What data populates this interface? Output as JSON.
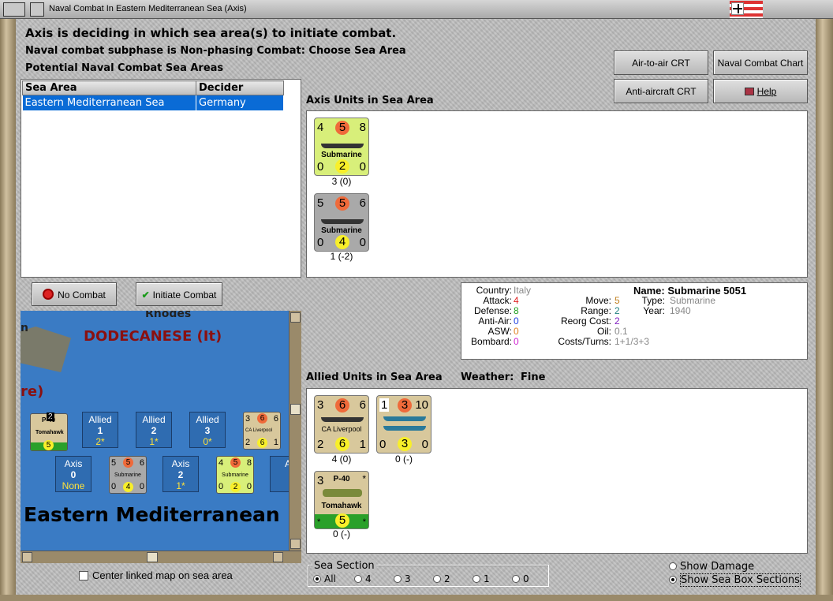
{
  "window": {
    "title": "Naval Combat In Eastern Mediterranean Sea (Axis)"
  },
  "header": {
    "line1": "Axis is deciding in which sea area(s) to initiate combat.",
    "line2": "Naval combat subphase is Non-phasing Combat: Choose Sea Area",
    "line3": "Potential Naval Combat Sea Areas"
  },
  "buttons": {
    "air_to_air": "Air-to-air CRT",
    "naval_chart": "Naval Combat Chart",
    "anti_aircraft": "Anti-aircraft CRT",
    "help": "Help",
    "no_combat": "No Combat",
    "initiate_combat": "Initiate Combat"
  },
  "sea_table": {
    "headers": [
      "Sea Area",
      "Decider"
    ],
    "rows": [
      [
        "Eastern Mediterranean Sea",
        "Germany"
      ]
    ]
  },
  "axis_section": {
    "title": "Axis Units in Sea Area",
    "units": [
      {
        "top_left": "4",
        "top_mid": "5",
        "top_right": "8",
        "name": "Submarine",
        "bot_left": "0",
        "bot_mid": "2",
        "bot_right": "0",
        "caption": "3 (0)",
        "color": "#d8ef7a"
      },
      {
        "top_left": "5",
        "top_mid": "5",
        "top_right": "6",
        "name": "Submarine",
        "bot_left": "0",
        "bot_mid": "4",
        "bot_right": "0",
        "caption": "1 (-2)",
        "color": "#a9a9a9"
      }
    ]
  },
  "info": {
    "country_label": "Country:",
    "country": "Italy",
    "attack_label": "Attack:",
    "attack": "4",
    "defense_label": "Defense:",
    "defense": "8",
    "antiair_label": "Anti-Air:",
    "antiair": "0",
    "asw_label": "ASW:",
    "asw": "0",
    "bombard_label": "Bombard:",
    "bombard": "0",
    "name_label": "Name:",
    "name": "Submarine 5051",
    "type_label": "Type:",
    "type": "Submarine",
    "year_label": "Year:",
    "year": "1940",
    "move_label": "Move:",
    "move": "5",
    "range_label": "Range:",
    "range": "2",
    "reorg_label": "Reorg Cost:",
    "reorg": "2",
    "oil_label": "Oil:",
    "oil": "0.1",
    "costs_label": "Costs/Turns:",
    "costs": "1+1/3+3"
  },
  "allied_section": {
    "title": "Allied Units in Sea Area",
    "weather_label": "Weather:",
    "weather": "Fine",
    "units": [
      {
        "top_left": "3",
        "top_mid": "6",
        "top_right": "6",
        "name": "CA Liverpool",
        "bot_left": "2",
        "bot_mid": "6",
        "bot_right": "1",
        "caption": "4 (0)"
      },
      {
        "top_left": "1",
        "top_mid": "3",
        "top_right": "10",
        "name": "",
        "bot_left": "0",
        "bot_mid": "3",
        "bot_right": "0",
        "caption": "0 (-)"
      },
      {
        "top_left": "3",
        "top_mid": "",
        "top_right": "*",
        "name": "P-40",
        "sub": "Tomahawk",
        "bot_left": "*",
        "bot_mid": "5",
        "bot_right": "*",
        "caption": "0 (-)"
      }
    ]
  },
  "map": {
    "rhodes": "Rhodes",
    "dodecanese": "DODECANESE (It)",
    "edge_n": "n",
    "edge_re": "re)",
    "sea_name": "Eastern Mediterranean",
    "allied_boxes": [
      {
        "label": "Allied",
        "num": "1",
        "val": "2*"
      },
      {
        "label": "Allied",
        "num": "2",
        "val": "1*"
      },
      {
        "label": "Allied",
        "num": "3",
        "val": "0*"
      }
    ],
    "axis_boxes": [
      {
        "label": "Axis",
        "num": "0",
        "val": "None"
      },
      {
        "label": "Axis",
        "num": "2",
        "val": "1*"
      },
      {
        "label": "A",
        "num": "",
        "val": ""
      }
    ],
    "p40_stack": "2",
    "p40_name": "P-40",
    "p40_sub": "Tomahawk",
    "p40_bot": "5",
    "ca_top": [
      "3",
      "6",
      "6"
    ],
    "ca_name": "CA Liverpool",
    "ca_bot": [
      "2",
      "6",
      "1"
    ],
    "sub1_top": [
      "5",
      "5",
      "6"
    ],
    "sub1_bot": [
      "0",
      "4",
      "0"
    ],
    "sub2_top": [
      "4",
      "5",
      "8"
    ],
    "sub2_bot": [
      "0",
      "2",
      "0"
    ],
    "sub_name": "Submarine"
  },
  "center_map_label": "Center linked map on sea area",
  "sea_section": {
    "title": "Sea Section",
    "options": [
      "All",
      "4",
      "3",
      "2",
      "1",
      "0"
    ],
    "selected": "All"
  },
  "show_damage": "Show Damage",
  "show_sea_box": "Show Sea Box Sections"
}
